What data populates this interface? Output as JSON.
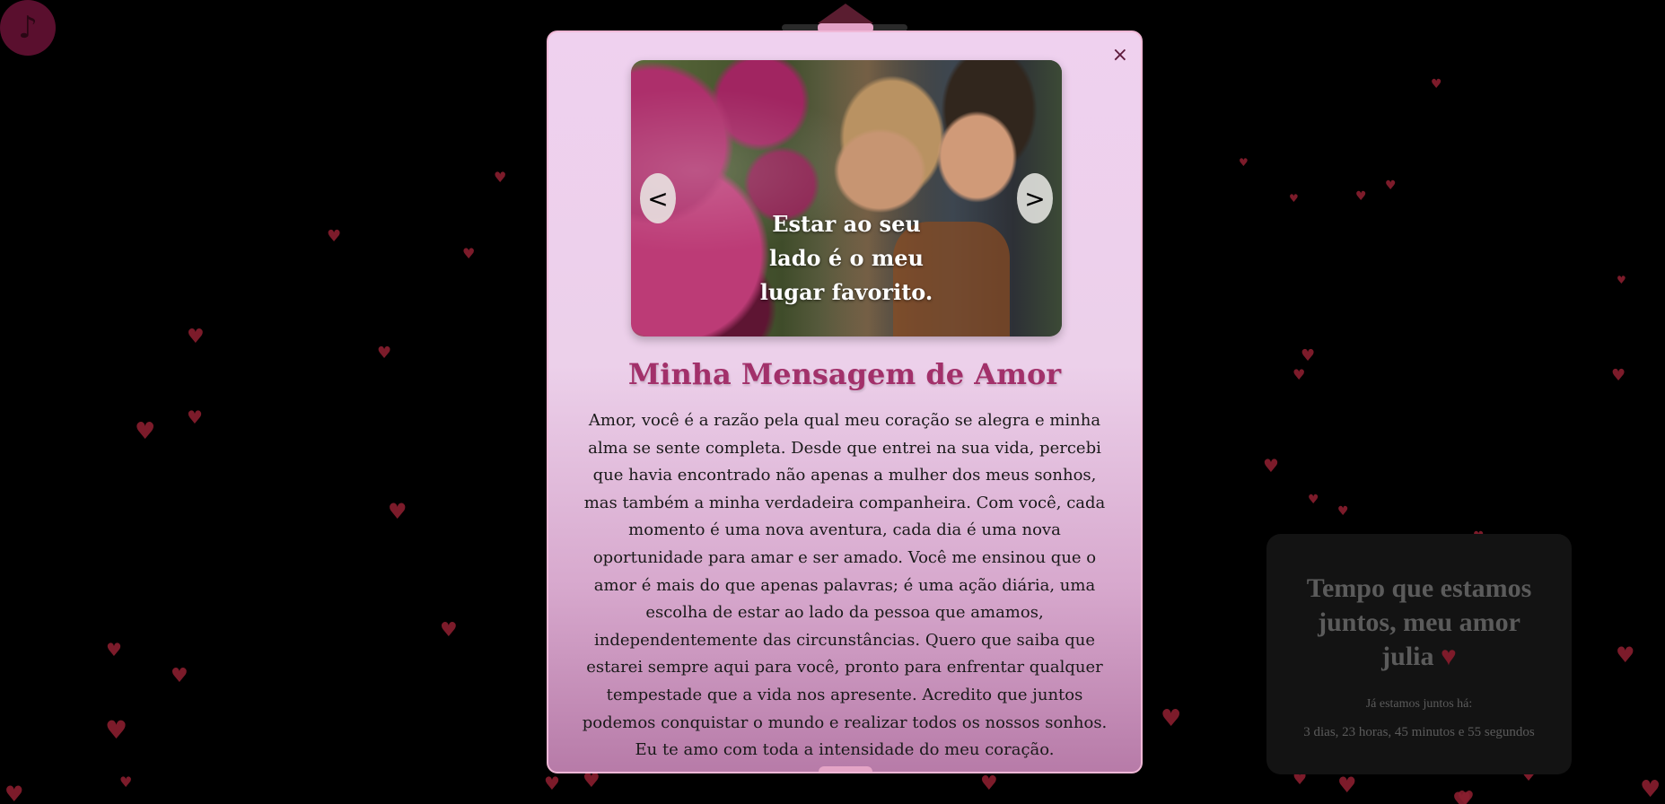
{
  "music": {
    "icon": "♪"
  },
  "counter": {
    "title_line1": "Tempo que estamos",
    "title_line2": "juntos, meu amor",
    "title_name": "julia",
    "since_label": "Já estamos juntos há:",
    "elapsed": "3 dias, 23 horas, 45 minutos e 55 segundos"
  },
  "modal": {
    "close_label": "×",
    "carousel": {
      "caption": "Estar ao seu lado é o meu lugar favorito.",
      "prev_label": "<",
      "next_label": ">"
    },
    "title": "Minha Mensagem de Amor",
    "message": "Amor, você é a razão pela qual meu coração se alegra e minha alma se sente completa. Desde que entrei na sua vida, percebi que havia encontrado não apenas a mulher dos meus sonhos, mas também a minha verdadeira companheira. Com você, cada momento é uma nova aventura, cada dia é uma nova oportunidade para amar e ser amado. Você me ensinou que o amor é mais do que apenas palavras; é uma ação diária, uma escolha de estar ao lado da pessoa que amamos, independentemente das circunstâncias. Quero que saiba que estarei sempre aqui para você, pronto para enfrentar qualquer tempestade que a vida nos apresente. Acredito que juntos podemos conquistar o mundo e realizar todos os nossos sonhos. Eu te amo com toda a intensidade do meu coração."
  },
  "colors": {
    "accent": "#a2306a",
    "heart": "#8a1f2f",
    "modal_border": "#f0b8d7"
  }
}
